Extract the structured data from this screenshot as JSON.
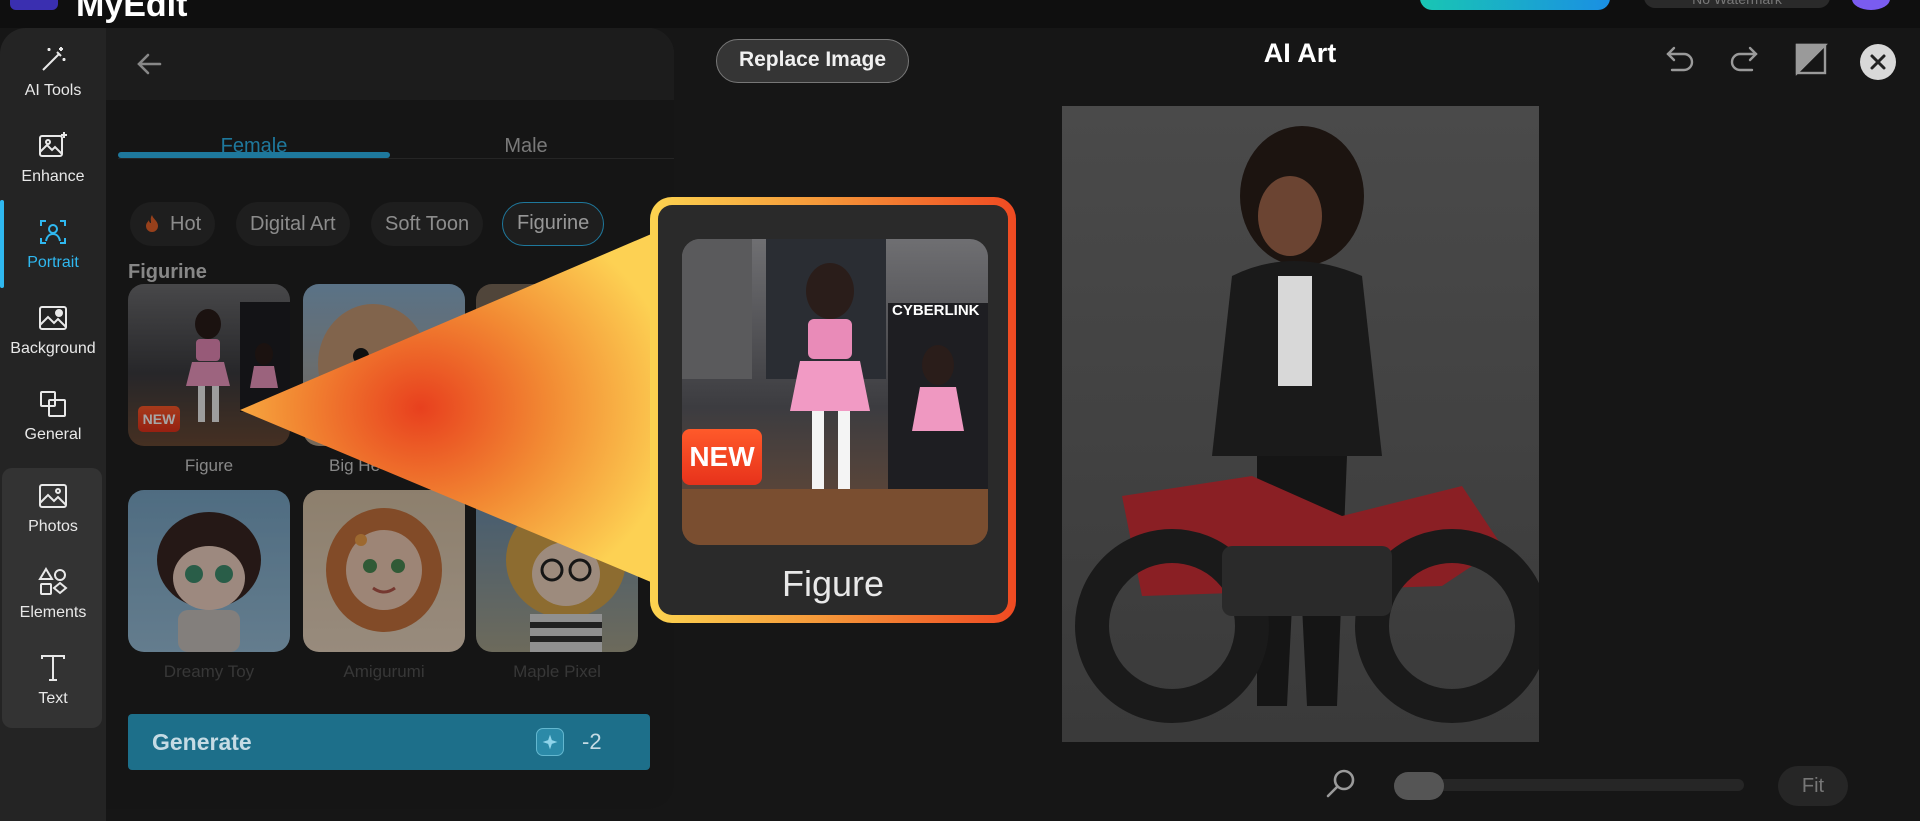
{
  "app": {
    "name": "MyEdit"
  },
  "top": {
    "watermark_label": "No Watermark"
  },
  "rail": {
    "items": [
      {
        "label": "AI Tools",
        "icon": "magic-wand-icon"
      },
      {
        "label": "Enhance",
        "icon": "image-enhance-icon"
      },
      {
        "label": "Portrait",
        "icon": "portrait-icon"
      },
      {
        "label": "Background",
        "icon": "background-icon"
      },
      {
        "label": "General",
        "icon": "general-icon"
      },
      {
        "label": "Photos",
        "icon": "photos-icon"
      },
      {
        "label": "Elements",
        "icon": "elements-icon"
      },
      {
        "label": "Text",
        "icon": "text-icon"
      }
    ],
    "active": "Portrait"
  },
  "panel": {
    "tabs": [
      {
        "label": "Female"
      },
      {
        "label": "Male"
      }
    ],
    "active_tab": "Female",
    "chips": [
      {
        "label": "Hot",
        "icon": "fire-icon"
      },
      {
        "label": "Digital Art"
      },
      {
        "label": "Soft Toon"
      },
      {
        "label": "Figurine"
      }
    ],
    "selected_chip": "Figurine",
    "section_title": "Figurine",
    "styles": [
      {
        "label": "Figure",
        "badge": "NEW"
      },
      {
        "label": "Big He"
      },
      {
        "label": ""
      },
      {
        "label": "Dreamy Toy"
      },
      {
        "label": "Amigurumi"
      },
      {
        "label": "Maple Pixel"
      }
    ],
    "generate": {
      "label": "Generate",
      "cost": "-2"
    }
  },
  "header": {
    "replace_label": "Replace Image",
    "title": "AI Art"
  },
  "callout": {
    "label": "Figure",
    "badge": "NEW",
    "brand_text": "CYBERLINK"
  },
  "footer": {
    "fit_label": "Fit"
  },
  "colors": {
    "accent": "#2fb8f0",
    "callout_start": "#fcd350",
    "callout_end": "#ef4a22"
  }
}
